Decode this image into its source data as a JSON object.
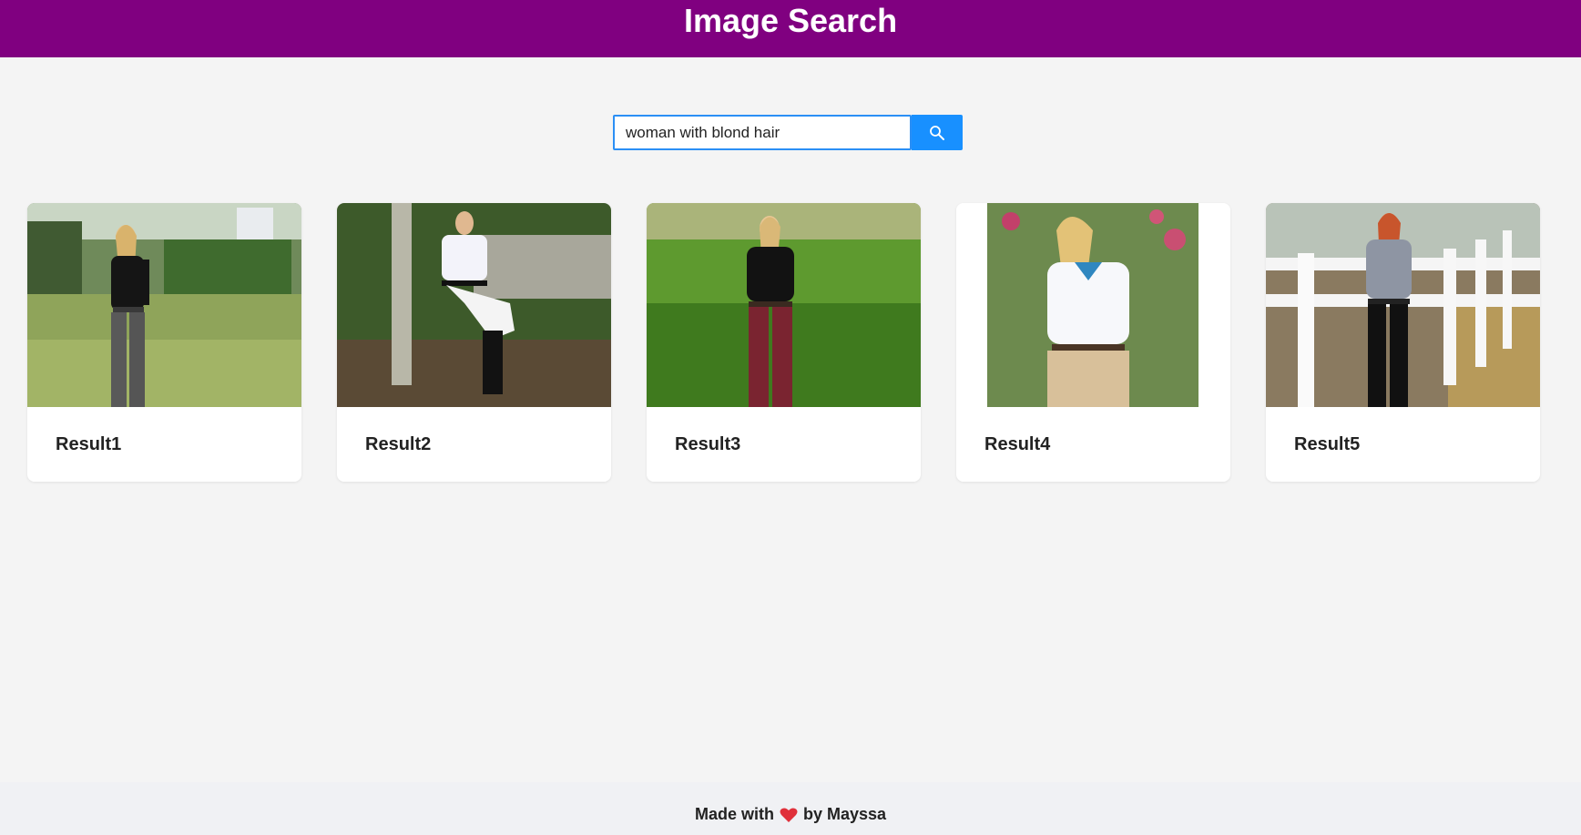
{
  "header": {
    "title": "Image Search"
  },
  "search": {
    "value": "woman with blond hair",
    "button_icon": "search-icon"
  },
  "results": [
    {
      "title": "Result1",
      "image_alt": "woman in black top and gray breeches on lawn"
    },
    {
      "title": "Result2",
      "image_alt": "woman in white shirt and white breeches leaning on post"
    },
    {
      "title": "Result3",
      "image_alt": "woman in black top and burgundy breeches on grass"
    },
    {
      "title": "Result4",
      "image_alt": "woman in white polo shirt and tan breeches"
    },
    {
      "title": "Result5",
      "image_alt": "woman in gray top and black breeches by white fence"
    }
  ],
  "footer": {
    "made_with": "Made with",
    "by": "by Mayssa",
    "heart_icon": "heart-icon"
  },
  "colors": {
    "header_bg": "#800080",
    "button_bg": "#1890ff",
    "page_bg": "#f4f4f4"
  }
}
